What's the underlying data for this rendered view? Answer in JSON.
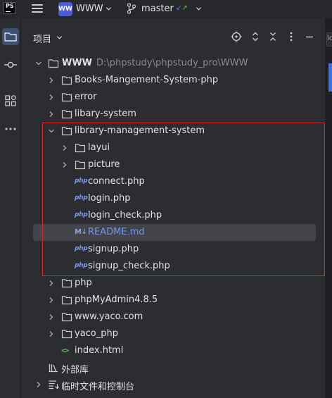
{
  "titlebar": {
    "app_logo": "PS",
    "project_badge": "WW",
    "project_name": "WWW",
    "branch_name": "master",
    "branch_arrows": "↙↗"
  },
  "panel": {
    "title": "项目"
  },
  "tree": {
    "root": {
      "name": "WWW",
      "path": "D:\\phpstudy\\phpstudy_pro\\WWW"
    },
    "items": [
      {
        "label": "Books-Mangement-System-php"
      },
      {
        "label": "error"
      },
      {
        "label": "libary-system"
      },
      {
        "label": "library-management-system"
      },
      {
        "label": "layui"
      },
      {
        "label": "picture"
      },
      {
        "label": "connect.php"
      },
      {
        "label": "login.php"
      },
      {
        "label": "login_check.php"
      },
      {
        "label": "README.md"
      },
      {
        "label": "signup.php"
      },
      {
        "label": "signup_check.php"
      },
      {
        "label": "php"
      },
      {
        "label": "phpMyAdmin4.8.5"
      },
      {
        "label": "www.yaco.com"
      },
      {
        "label": "yaco_php"
      },
      {
        "label": "index.html"
      }
    ],
    "external_libs": "外部库",
    "scratches": "临时文件和控制台",
    "php_icon_text": "php",
    "md_icon_text": "M↓",
    "html_icon_text": "<>"
  },
  "right_edge": {
    "tab_letter": "lc"
  },
  "colors": {
    "background": "#2b2d30",
    "selection": "#43454a",
    "highlight_border": "#e0252a",
    "accent_blue": "#3574f0",
    "php_icon": "#7a9bff"
  }
}
